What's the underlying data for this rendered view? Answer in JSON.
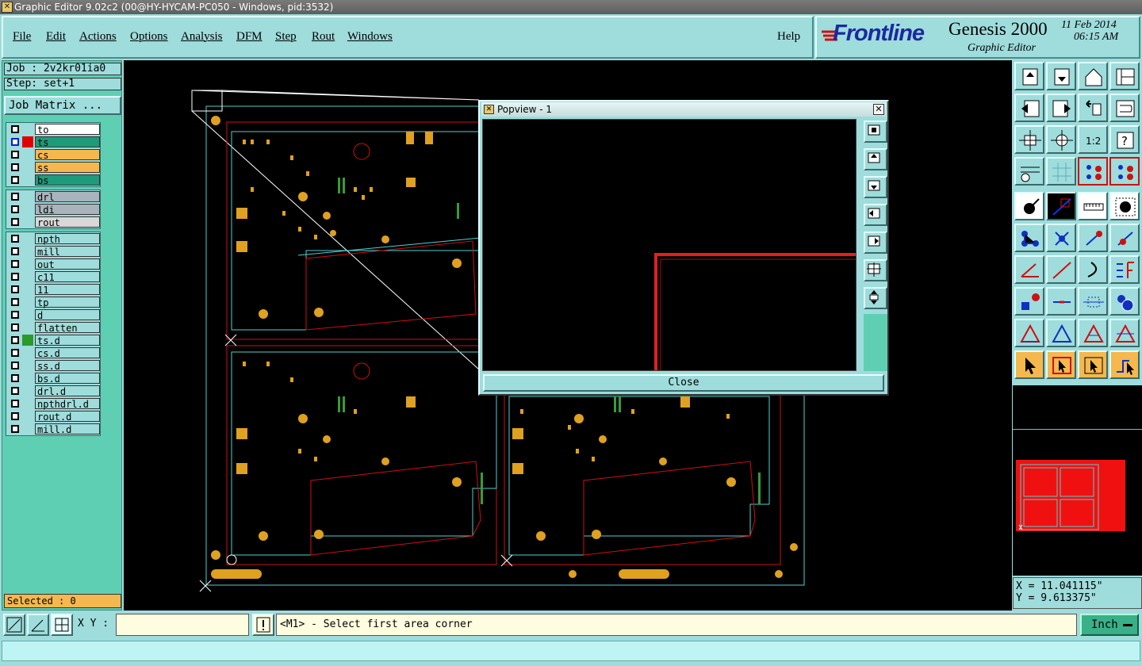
{
  "window": {
    "title": "Graphic Editor 9.02c2 (00@HY-HYCAM-PC050 - Windows, pid:3532)"
  },
  "menu": {
    "items": [
      "File",
      "Edit",
      "Actions",
      "Options",
      "Analysis",
      "DFM",
      "Step",
      "Rout",
      "Windows"
    ],
    "help": "Help"
  },
  "brand": {
    "logo": "Frontline",
    "product": "Genesis 2000",
    "subtitle": "Graphic Editor",
    "date": "11 Feb 2014",
    "time": "06:15 AM"
  },
  "job": {
    "job_label": "Job : 2v2kr01ia0",
    "step_label": "Step: set+1",
    "matrix_button": "Job Matrix ..."
  },
  "layers": {
    "board": [
      {
        "name": "to",
        "color": "#ffffff"
      },
      {
        "name": "ts",
        "color": "#1f9a7a",
        "state": "#e00000"
      },
      {
        "name": "cs",
        "color": "#f5b84e"
      },
      {
        "name": "ss",
        "color": "#f5b84e"
      },
      {
        "name": "bs",
        "color": "#1f9a7a"
      }
    ],
    "drill": [
      {
        "name": "drl",
        "color": "#a8b4bc"
      },
      {
        "name": "ldi",
        "color": "#a8b4bc"
      },
      {
        "name": "rout",
        "color": "#d8d8d8"
      }
    ],
    "misc": [
      {
        "name": "npth",
        "color": "#9fdcdc"
      },
      {
        "name": "mill",
        "color": "#9fdcdc"
      },
      {
        "name": "out",
        "color": "#9fdcdc"
      },
      {
        "name": "c11",
        "color": "#9fdcdc"
      },
      {
        "name": "11",
        "color": "#9fdcdc"
      },
      {
        "name": "tp",
        "color": "#9fdcdc"
      },
      {
        "name": "d",
        "color": "#9fdcdc"
      },
      {
        "name": "flatten",
        "color": "#9fdcdc"
      },
      {
        "name": "ts.d",
        "color": "#9fdcdc",
        "state": "#2a9a2a"
      },
      {
        "name": "cs.d",
        "color": "#9fdcdc"
      },
      {
        "name": "ss.d",
        "color": "#9fdcdc"
      },
      {
        "name": "bs.d",
        "color": "#9fdcdc"
      },
      {
        "name": "drl.d",
        "color": "#9fdcdc"
      },
      {
        "name": "npthdrl.d",
        "color": "#9fdcdc"
      },
      {
        "name": "rout.d",
        "color": "#9fdcdc"
      },
      {
        "name": "mill.d",
        "color": "#9fdcdc"
      }
    ]
  },
  "selection": {
    "label": "Selected : 0"
  },
  "popview": {
    "title": "Popview - 1",
    "close_label": "Close"
  },
  "coords": {
    "x": "X = 11.041115\"",
    "y": "Y = 9.613375\""
  },
  "status": {
    "xy_label": "X Y :",
    "xy_value": "",
    "message": "<M1> - Select first area corner",
    "unit": "Inch"
  }
}
